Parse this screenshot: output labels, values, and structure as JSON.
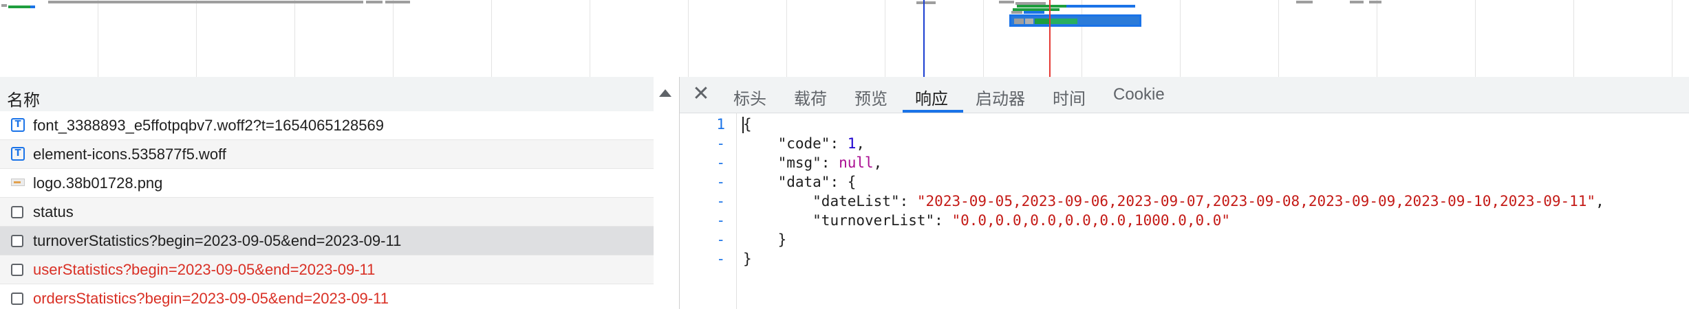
{
  "timeline": {
    "colors": {
      "cursor_blue": "#1a3ed1",
      "cursor_red": "#e53935",
      "request_gray": "#9e9e9e",
      "request_green": "#1e9e3e",
      "request_blue": "#1a73e8"
    }
  },
  "request_list": {
    "header_label": "名称",
    "sort_icon": "sort-ascending-icon",
    "items": [
      {
        "icon": "font-file-icon",
        "icon_glyph": "T",
        "label": "font_3388893_e5ffotpqbv7.woff2?t=1654065128569",
        "color": "#1f1f1f",
        "selected": false
      },
      {
        "icon": "font-file-icon",
        "icon_glyph": "T",
        "label": "element-icons.535877f5.woff",
        "color": "#1f1f1f",
        "selected": false
      },
      {
        "icon": "image-file-icon",
        "icon_glyph": "",
        "label": "logo.38b01728.png",
        "color": "#1f1f1f",
        "selected": false
      },
      {
        "icon": "checkbox-icon",
        "icon_glyph": "",
        "label": "status",
        "color": "#1f1f1f",
        "selected": false
      },
      {
        "icon": "checkbox-icon",
        "icon_glyph": "",
        "label": "turnoverStatistics?begin=2023-09-05&end=2023-09-11",
        "color": "#1f1f1f",
        "selected": true
      },
      {
        "icon": "checkbox-icon",
        "icon_glyph": "",
        "label": "userStatistics?begin=2023-09-05&end=2023-09-11",
        "color": "#d93025",
        "selected": false
      },
      {
        "icon": "checkbox-icon",
        "icon_glyph": "",
        "label": "ordersStatistics?begin=2023-09-05&end=2023-09-11",
        "color": "#d93025",
        "selected": false
      }
    ]
  },
  "detail": {
    "close_icon": "close-icon",
    "tabs": [
      {
        "label": "标头",
        "active": false
      },
      {
        "label": "载荷",
        "active": false
      },
      {
        "label": "预览",
        "active": false
      },
      {
        "label": "响应",
        "active": true
      },
      {
        "label": "启动器",
        "active": false
      },
      {
        "label": "时间",
        "active": false
      },
      {
        "label": "Cookie",
        "active": false
      }
    ],
    "response": {
      "line_numbers": [
        "1",
        "-",
        "-",
        "-",
        "-",
        "-",
        "-",
        "-"
      ],
      "open_brace": "{",
      "code_key": "\"code\"",
      "code_value": "1",
      "msg_key": "\"msg\"",
      "msg_value": "null",
      "data_key": "\"data\"",
      "dateList_key": "\"dateList\"",
      "dateList_value": "\"2023-09-05,2023-09-06,2023-09-07,2023-09-08,2023-09-09,2023-09-10,2023-09-11\"",
      "turnoverList_key": "\"turnoverList\"",
      "turnoverList_value": "\"0.0,0.0,0.0,0.0,0.0,1000.0,0.0\"",
      "inner_close": "}",
      "outer_close": "}"
    }
  }
}
